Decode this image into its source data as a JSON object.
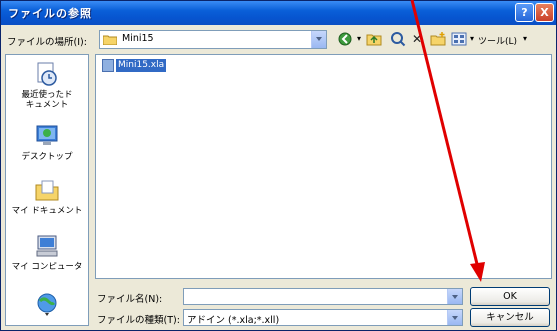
{
  "window": {
    "title": "ファイルの参照"
  },
  "titlebar": {
    "help_glyph": "?",
    "close_glyph": "X"
  },
  "lookin": {
    "label": "ファイルの場所(I):",
    "value": "Mini15"
  },
  "toolbar": {
    "icons": [
      "back-icon",
      "up-folder-icon",
      "search-web-icon",
      "delete-icon",
      "new-folder-icon",
      "views-icon"
    ],
    "tools_label": "ツール(L)"
  },
  "places": [
    {
      "label": "最近使ったド\nキュメント",
      "icon": "recent-documents-icon"
    },
    {
      "label": "デスクトップ",
      "icon": "desktop-icon"
    },
    {
      "label": "マイ ドキュメント",
      "icon": "my-documents-icon"
    },
    {
      "label": "マイ コンピュータ",
      "icon": "my-computer-icon"
    },
    {
      "label": "",
      "icon": "network-places-icon"
    }
  ],
  "files": [
    {
      "name": "Mini15.xla",
      "selected": true
    }
  ],
  "filename": {
    "label": "ファイル名(N):",
    "value": ""
  },
  "filetype": {
    "label": "ファイルの種類(T):",
    "value": "アドイン (*.xla;*.xll)"
  },
  "buttons": {
    "ok": "OK",
    "cancel": "キャンセル"
  },
  "colors": {
    "title_bar": "#0a5fd8",
    "selection": "#316ac5",
    "annotation_arrow": "#e00000"
  }
}
